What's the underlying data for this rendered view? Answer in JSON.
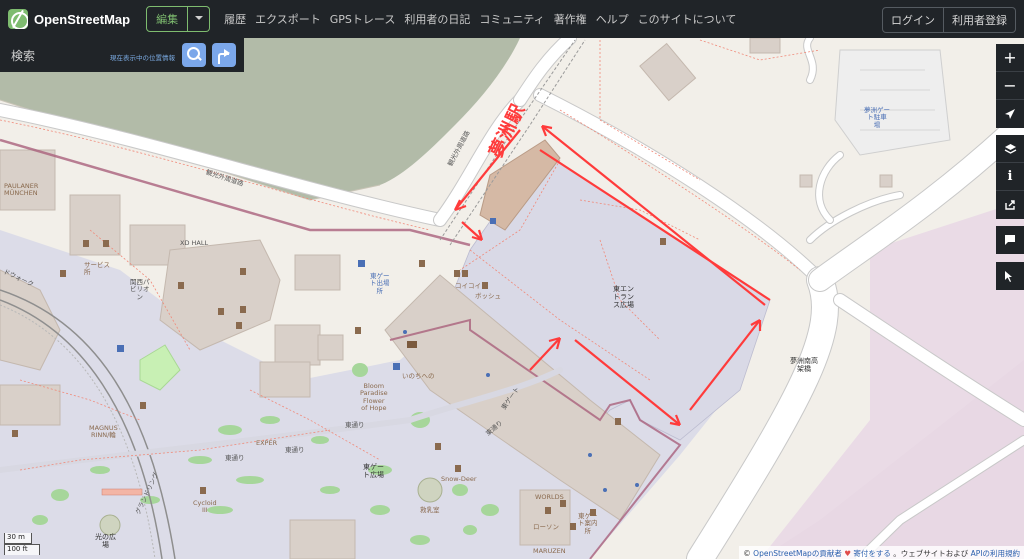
{
  "header": {
    "logo_text": "OpenStreetMap",
    "edit_label": "編集",
    "nav": [
      "履歴",
      "エクスポート",
      "GPSトレース",
      "利用者の日記",
      "コミュニティ",
      "著作権",
      "ヘルプ",
      "このサイトについて"
    ],
    "login_label": "ログイン",
    "signup_label": "利用者登録"
  },
  "search": {
    "placeholder": "検索",
    "where_am_i": "現在表示中の位置情報"
  },
  "controls": {
    "zoom_in": "+",
    "zoom_out": "−",
    "info": "i"
  },
  "map_labels": {
    "station": "夢洲駅",
    "east_entrance_plaza": "東エン\nトラン\nス広場",
    "bridge": "夢洲南高\n架橋",
    "kanko_road_1": "観光外周道路",
    "kanko_road_2": "観光外周道路",
    "paulaner": "PAULANER\nMÜNCHEN",
    "xd_hall": "XD HALL",
    "kansai_pavilion": "関西パ\nビリオ\nン",
    "service": "サービス\n所",
    "east_gate_exit": "東ゲー\nト出場\n所",
    "coicoi": "コイコイ",
    "bosh": "ボッシュ",
    "inochi": "いのちへの",
    "bloom": "Bloom\nParadise\nFlower\nof Hope",
    "east_gate": "東ゲート",
    "higashi_dori_1": "東通り",
    "higashi_dori_2": "東通り",
    "higashi_dori_3": "東通り",
    "higashi_dori_4": "東通り",
    "expr": "EXPER",
    "east_gate_plaza": "東ゲー\nト広場",
    "snow_deer": "Snow-Deer",
    "kyubo": "救乳室",
    "magnus": "MAGNUS\nRINN/輪",
    "cycloid": "Cycloid\nIII",
    "hikari": "光の広\n場",
    "world": "WORLDS",
    "lawson": "ローソン",
    "maruzen": "MARUZEN",
    "higashi_gate_office": "東ゲー\nト案内\n所",
    "parking": "夢洲ゲー\nト駐車\n場",
    "grand_ring_1": "グランドリング",
    "grand_ring_2": "ドウォーク"
  },
  "scale": {
    "metric": "30 m",
    "imperial": "100 ft"
  },
  "attribution": {
    "prefix": "©",
    "osm_contributors": "OpenStreetMapの貢献者",
    "heart": "♥",
    "donate": "寄付をする",
    "middle": "。ウェブサイトおよび",
    "api_terms": "APIの利用規約"
  },
  "colors": {
    "header_bg": "#202428",
    "accent_green": "#7ebc6f",
    "button_blue": "#7ba7ea",
    "annotation_red": "#ff3b3b",
    "water": "#aab9a3",
    "pedestrian": "#dcdce8",
    "building": "#d9d0c9"
  }
}
